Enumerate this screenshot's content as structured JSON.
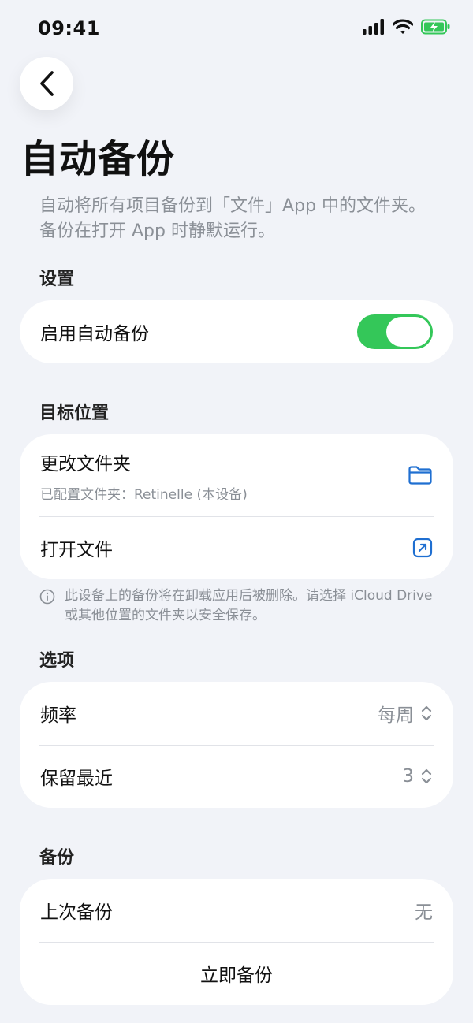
{
  "status": {
    "time": "09:41"
  },
  "header": {
    "title": "自动备份",
    "description": "自动将所有项目备份到「文件」App 中的文件夹。备份在打开 App 时静默运行。"
  },
  "settings": {
    "section_title": "设置",
    "auto_backup_label": "启用自动备份",
    "auto_backup_enabled": true
  },
  "destination": {
    "section_title": "目标位置",
    "change_folder_label": "更改文件夹",
    "configured_folder_text": "已配置文件夹：Retinelle (本设备)",
    "open_files_label": "打开文件",
    "note": "此设备上的备份将在卸载应用后被删除。请选择 iCloud Drive 或其他位置的文件夹以安全保存。"
  },
  "options": {
    "section_title": "选项",
    "frequency_label": "频率",
    "frequency_value": "每周",
    "keep_recent_label": "保留最近",
    "keep_recent_value": "3"
  },
  "backup": {
    "section_title": "备份",
    "last_backup_label": "上次备份",
    "last_backup_value": "无",
    "backup_now_label": "立即备份"
  },
  "colors": {
    "accent": "#1f6fd1",
    "toggle_on": "#34c759",
    "background": "#f1f3f8"
  }
}
